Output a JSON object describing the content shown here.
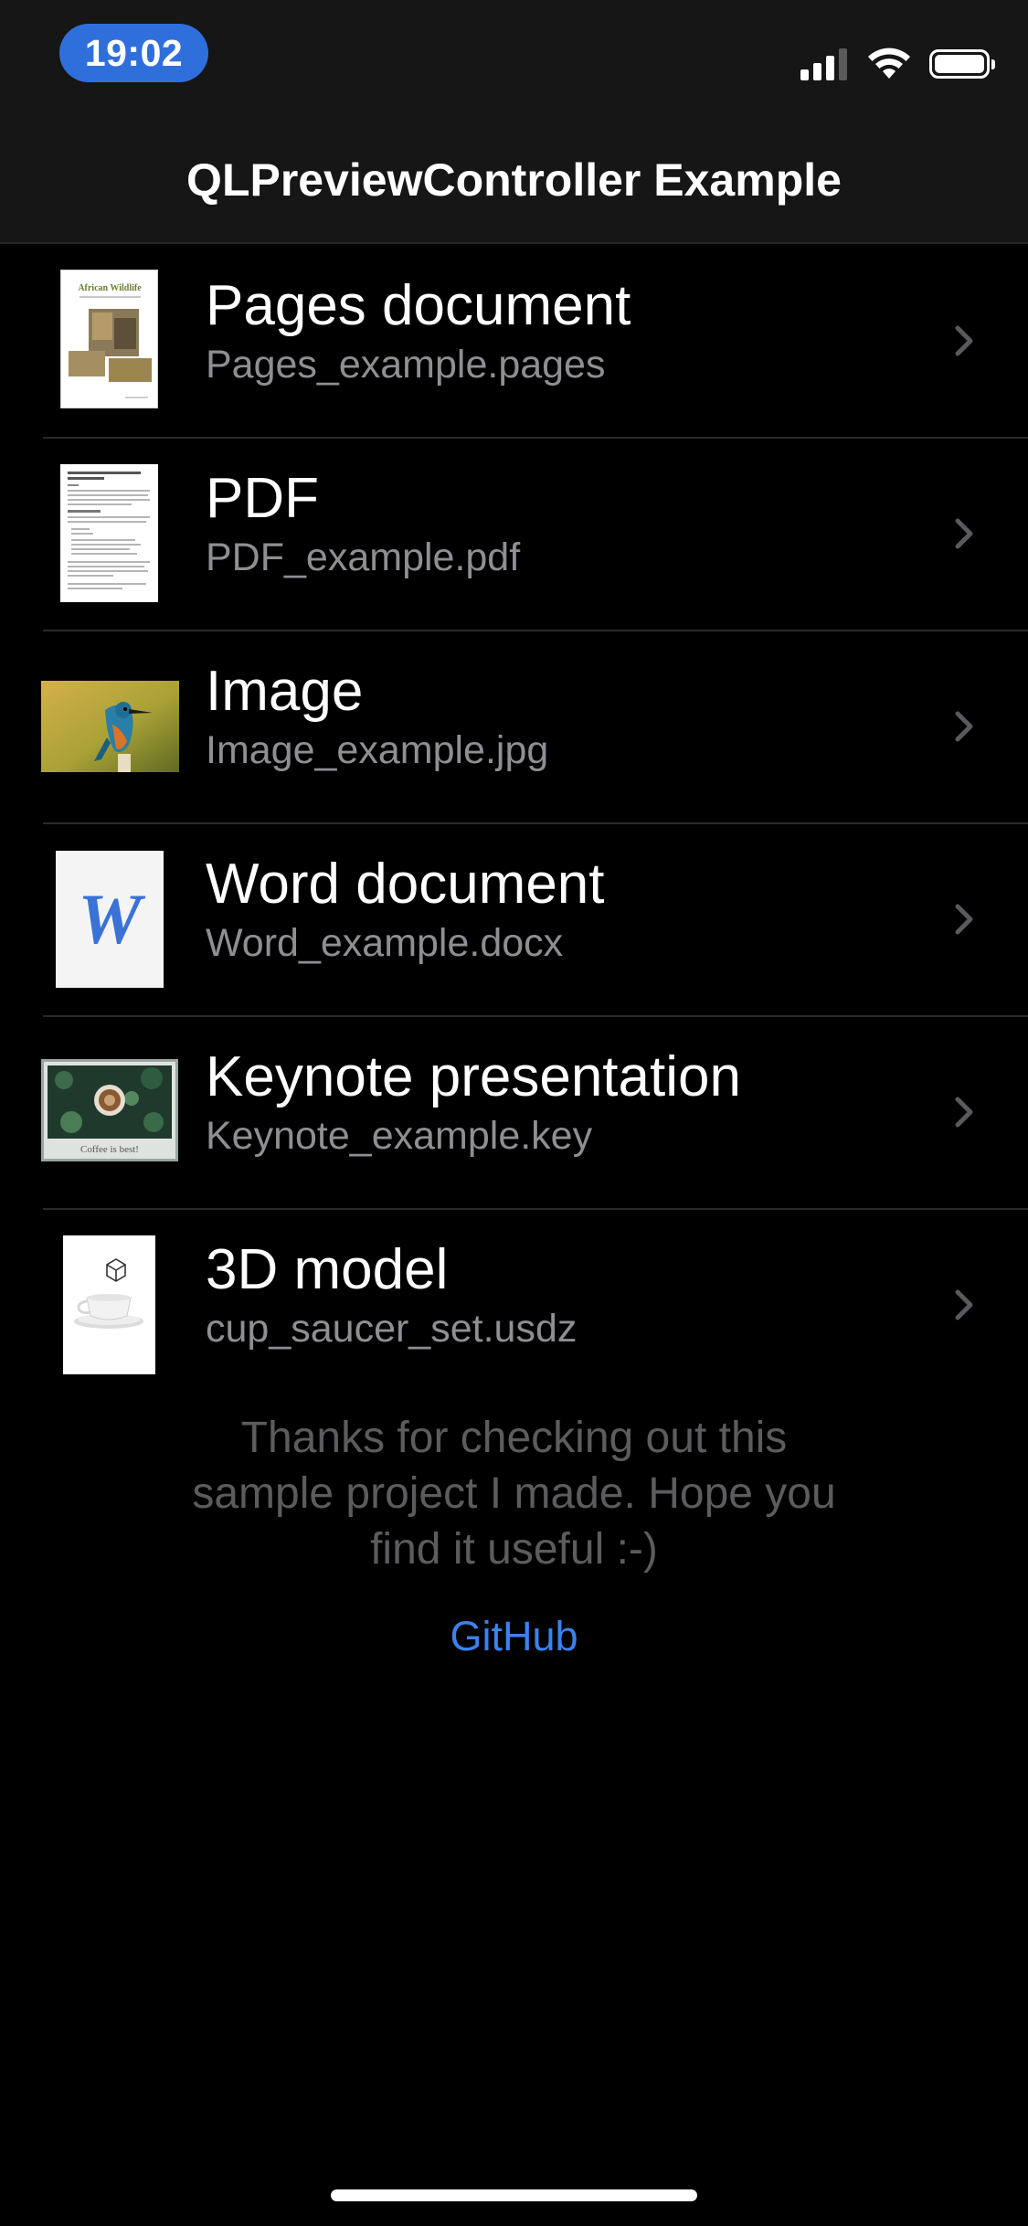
{
  "status_bar": {
    "time": "19:02",
    "signal_icon": "cellular-signal-icon",
    "wifi_icon": "wifi-icon",
    "battery_icon": "battery-icon"
  },
  "nav": {
    "title": "QLPreviewController Example"
  },
  "items": [
    {
      "title": "Pages document",
      "subtitle": "Pages_example.pages",
      "thumbnail": "pages-document-thumbnail",
      "thumb_text": "African Wildlife"
    },
    {
      "title": "PDF",
      "subtitle": "PDF_example.pdf",
      "thumbnail": "pdf-document-thumbnail"
    },
    {
      "title": "Image",
      "subtitle": "Image_example.jpg",
      "thumbnail": "kingfisher-photo-thumbnail"
    },
    {
      "title": "Word document",
      "subtitle": "Word_example.docx",
      "thumbnail": "word-document-thumbnail",
      "thumb_text": "W"
    },
    {
      "title": "Keynote presentation",
      "subtitle": "Keynote_example.key",
      "thumbnail": "keynote-slide-thumbnail",
      "thumb_text": "Coffee is best!"
    },
    {
      "title": "3D model",
      "subtitle": "cup_saucer_set.usdz",
      "thumbnail": "cup-saucer-3d-thumbnail"
    }
  ],
  "footer": {
    "message": "Thanks for checking out this sample project I made. Hope you find it useful :-)",
    "link_label": "GitHub"
  },
  "colors": {
    "background": "#000000",
    "bar_background": "#161616",
    "time_pill": "#2f6fdb",
    "subtitle": "#8e8e93",
    "footer_text": "#5c5c5f",
    "link": "#3b82f0",
    "chevron": "#5a5a5e"
  }
}
